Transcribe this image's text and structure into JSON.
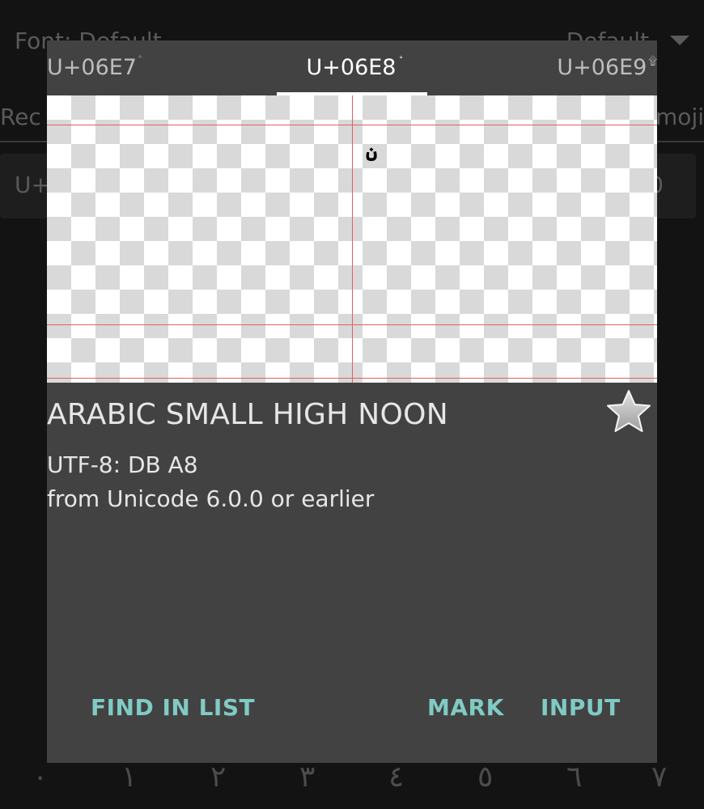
{
  "background": {
    "font_label": "Font: Default",
    "font_value": "Default",
    "tab_left": "Rec",
    "tab_right": "moji",
    "search_left": "U+",
    "search_right": "0",
    "bottom_digits": [
      "٠",
      "١",
      "٢",
      "٣",
      "٤",
      "٥",
      "٦",
      "٧"
    ]
  },
  "dialog": {
    "tabs": [
      {
        "label": "U+06E7",
        "glyph": "ۧ"
      },
      {
        "label": "U+06E8",
        "glyph": "ۨ"
      },
      {
        "label": "U+06E9",
        "glyph": "۩"
      }
    ],
    "preview_glyph": "ۨ",
    "char_name": "ARABIC SMALL HIGH NOON",
    "utf8": "UTF-8: DB A8",
    "version": "from Unicode 6.0.0 or earlier",
    "favorite_icon": "star-icon",
    "buttons": {
      "find": "FIND IN LIST",
      "mark": "MARK",
      "input": "INPUT"
    }
  },
  "colors": {
    "dialog_bg": "#424242",
    "accent": "#80cbc4",
    "guide_lines": "#e06060"
  }
}
